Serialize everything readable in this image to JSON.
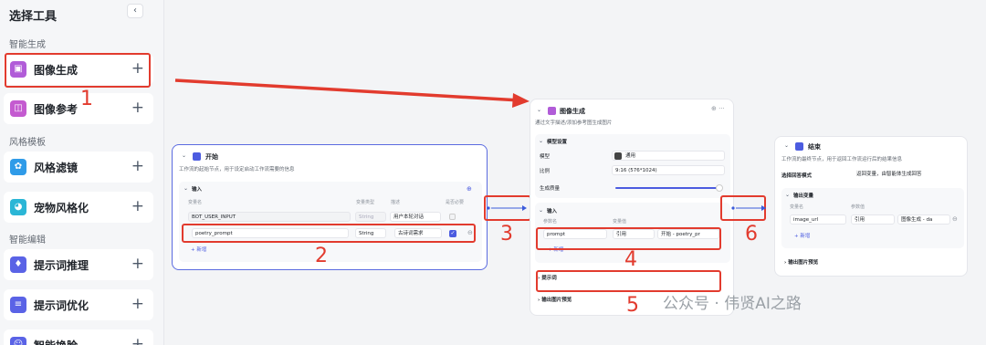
{
  "sidebar": {
    "title": "选择工具",
    "collapse_icon": "‹",
    "sections": [
      {
        "label": "智能生成"
      },
      {
        "label": "风格模板"
      },
      {
        "label": "智能编辑"
      }
    ],
    "items": [
      {
        "label": "图像生成",
        "icon": "image-gen-icon",
        "color": "#b15cd8"
      },
      {
        "label": "图像参考",
        "icon": "image-ref-icon",
        "color": "#c45bd0"
      },
      {
        "label": "风格滤镜",
        "icon": "filter-icon",
        "color": "#2f9be8"
      },
      {
        "label": "宠物风格化",
        "icon": "pet-icon",
        "color": "#2bb6d6"
      },
      {
        "label": "提示词推理",
        "icon": "bulb-icon",
        "color": "#5a63e6"
      },
      {
        "label": "提示词优化",
        "icon": "list-icon",
        "color": "#5a63e6"
      },
      {
        "label": "智能换脸",
        "icon": "face-icon",
        "color": "#5a63e6"
      }
    ],
    "plus": "+"
  },
  "annotations": [
    "1",
    "2",
    "3",
    "4",
    "5",
    "6"
  ],
  "start_node": {
    "title": "开始",
    "desc": "工作流的起始节点，用于设定启动工作流需要的信息",
    "input_label": "输入",
    "col_name": "变量名",
    "col_type": "变量类型",
    "col_desc": "描述",
    "col_required": "是否必要",
    "rows": [
      {
        "name": "BOT_USER_INPUT",
        "type": "String",
        "desc": "用户本轮对话"
      },
      {
        "name": "poetry_prompt",
        "type": "String",
        "desc": "古诗词需求"
      }
    ],
    "add": "+ 新增"
  },
  "image_node": {
    "title": "图像生成",
    "desc": "通过文字描述/添加参考图生成图片",
    "model_settings": "模型设置",
    "model_label": "模型",
    "model_value": "通用",
    "ratio_label": "比例",
    "ratio_value": "9:16 (576*1024)",
    "quality_label": "生成质量",
    "input_label": "输入",
    "col_name": "参数名",
    "col_value": "变量值",
    "param_name": "prompt",
    "param_ref": "引用",
    "param_value": "开始 - poetry_pr",
    "add": "+ 新增",
    "prompt_section": "提示词",
    "preview_section": "输出图片预览"
  },
  "end_node": {
    "title": "结束",
    "desc": "工作流的最终节点，用于返回工作流运行后的结果信息",
    "answer_mode_label": "选择回答模式",
    "answer_mode_value": "返回变量，由智能体生成回答",
    "output_label": "输出变量",
    "col_name": "变量名",
    "col_value": "参数值",
    "var_name": "image_url",
    "var_ref": "引用",
    "var_value": "图像生成 - da",
    "add": "+ 新增",
    "preview_section": "输出图片预览"
  },
  "watermark": "公众号 · 伟贤AI之路",
  "colors": {
    "highlight": "#e23b2e",
    "accent": "#4c5ce0",
    "arrow": "#e23b2e"
  }
}
